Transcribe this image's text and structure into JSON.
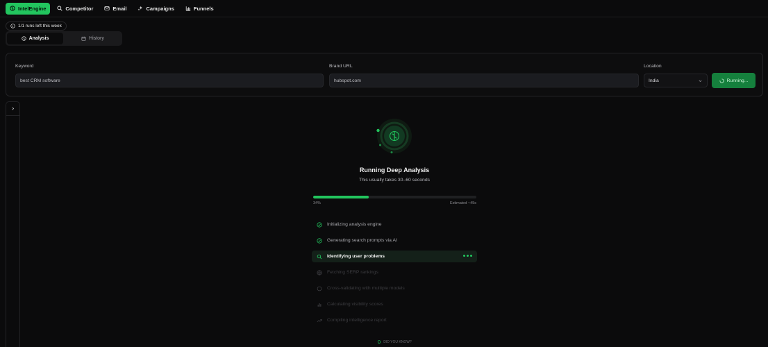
{
  "nav": {
    "items": [
      {
        "label": "IntelEngine",
        "icon": "brain-icon",
        "active": true
      },
      {
        "label": "Competitor",
        "icon": "search-icon",
        "active": false
      },
      {
        "label": "Email",
        "icon": "mail-icon",
        "active": false
      },
      {
        "label": "Campaigns",
        "icon": "sparkles-icon",
        "active": false
      },
      {
        "label": "Funnels",
        "icon": "bar-chart-icon",
        "active": false
      }
    ]
  },
  "runs_left": "1/1 runs left this week",
  "tabs": [
    {
      "label": "Analysis",
      "icon": "target-icon",
      "active": true
    },
    {
      "label": "History",
      "icon": "calendar-icon",
      "active": false
    }
  ],
  "form": {
    "keyword_label": "Keyword",
    "keyword_value": "best CRM software",
    "brand_label": "Brand URL",
    "brand_value": "hubspot.com",
    "location_label": "Location",
    "location_value": "India",
    "run_button": "Running..."
  },
  "status": {
    "title": "Running Deep Analysis",
    "subtitle": "This usually takes 30–60 seconds",
    "progress_pct": 34,
    "progress_label": "34%",
    "eta_label": "Estimated ~45s"
  },
  "steps": [
    {
      "label": "Initializing analysis engine",
      "state": "done"
    },
    {
      "label": "Generating search prompts via AI",
      "state": "done"
    },
    {
      "label": "Identifying user problems",
      "state": "active"
    },
    {
      "label": "Fetching SERP rankings",
      "state": "pending"
    },
    {
      "label": "Cross-validating with multiple models",
      "state": "pending"
    },
    {
      "label": "Calculating visibility scores",
      "state": "pending"
    },
    {
      "label": "Compiling intelligence report",
      "state": "pending"
    }
  ],
  "did_you_know": "DID YOU KNOW?",
  "colors": {
    "accent": "#22c55e",
    "accent_dark": "#15803d",
    "background": "#0b0b0c"
  }
}
